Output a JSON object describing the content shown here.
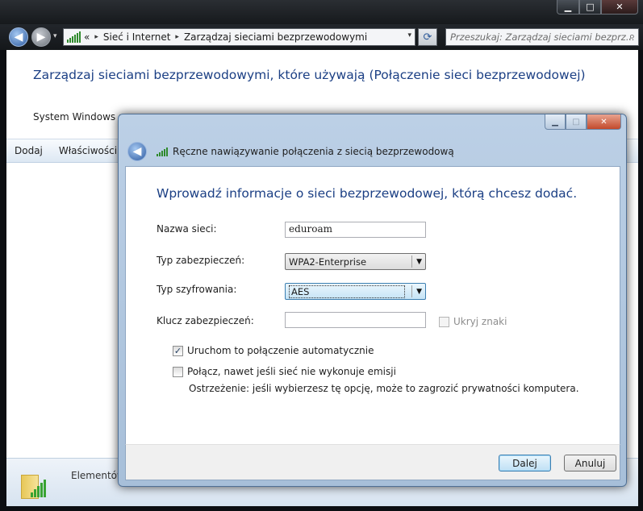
{
  "window": {
    "caption": {
      "minimize": "▁",
      "maximize": "□",
      "close": "✕"
    }
  },
  "navigation": {
    "back_glyph": "◀",
    "forward_glyph": "▶",
    "history_glyph": "▾",
    "address": {
      "overflow": "«",
      "separator": "▸",
      "crumbs": [
        "Sieć i Internet",
        "Zarządzaj sieciami bezprzewodowymi"
      ],
      "dropdown_glyph": "▾"
    },
    "refresh_glyph": "⟳",
    "search": {
      "placeholder": "Przeszukaj: Zarządzaj sieciami bezprz...",
      "icon_glyph": "⌕"
    }
  },
  "main": {
    "heading": "Zarządzaj sieciami bezprzewodowymi, które używają (Połączenie sieci bezprzewodowej)",
    "description": "System Windows pr",
    "toolbar": {
      "add": "Dodaj",
      "properties": "Właściwości ka"
    },
    "details": {
      "label": "Elementów"
    }
  },
  "dialog": {
    "caption": {
      "minimize": "▁",
      "maximize": "□",
      "close": "✕"
    },
    "back_glyph": "◀",
    "title": "Ręczne nawiązywanie połączenia z siecią bezprzewodową",
    "heading": "Wprowadź informacje o sieci bezprzewodowej, którą chcesz dodać.",
    "fields": {
      "network_name_label": "Nazwa sieci:",
      "network_name_value": "eduroam",
      "security_type_label": "Typ zabezpieczeń:",
      "security_type_value": "WPA2-Enterprise",
      "encryption_type_label": "Typ szyfrowania:",
      "encryption_type_value": "AES",
      "security_key_label": "Klucz zabezpieczeń:",
      "security_key_value": "",
      "hide_chars_label": "Ukryj znaki"
    },
    "options": {
      "auto_start_label": "Uruchom to połączenie automatycznie",
      "auto_start_checked": "✓",
      "connect_hidden_label": "Połącz, nawet jeśli sieć nie wykonuje emisji",
      "warning": "Ostrzeżenie: jeśli wybierzesz tę opcję, może to zagrozić prywatności komputera."
    },
    "dropdown_glyph": "▼",
    "buttons": {
      "next": "Dalej",
      "cancel": "Anuluj"
    }
  }
}
